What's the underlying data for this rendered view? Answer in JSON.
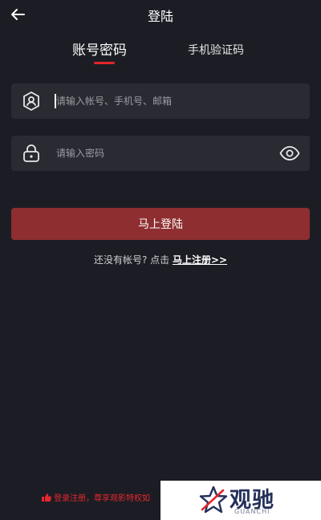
{
  "header": {
    "title": "登陆"
  },
  "tabs": {
    "account": "账号密码",
    "sms": "手机验证码"
  },
  "form": {
    "user_placeholder": "请输入帐号、手机号、邮箱",
    "user_value": "",
    "password_placeholder": "请输入密码",
    "password_value": ""
  },
  "login_button": {
    "label": "马上登陆"
  },
  "register": {
    "prompt": "还没有帐号? 点击 ",
    "link": "马上注册>>"
  },
  "agreement": {
    "text": "登录注册，尊享观影特权如"
  },
  "watermark": {
    "name": "观驰",
    "sub": "GUANCHI"
  },
  "colors": {
    "background": "#1c1d24",
    "field": "#2a2b32",
    "accent": "#e5262b",
    "button": "#8e2e30"
  }
}
